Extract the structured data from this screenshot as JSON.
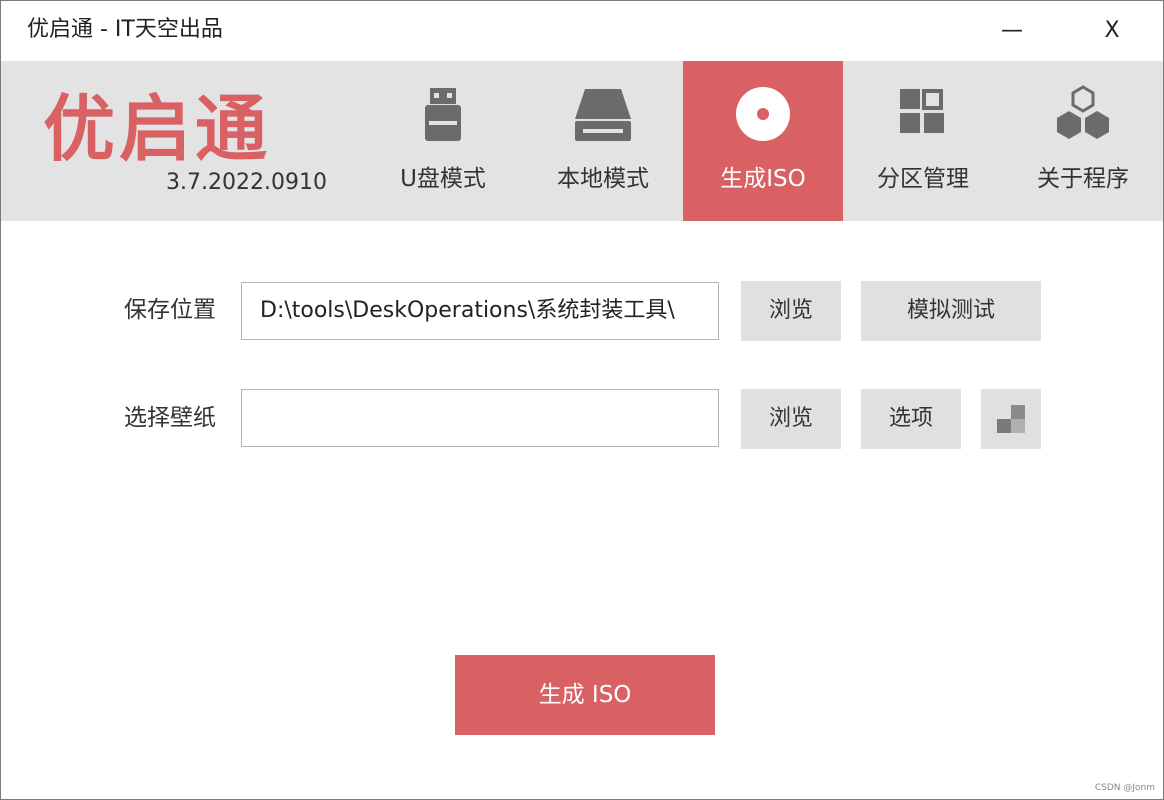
{
  "window": {
    "title": "优启通 - IT天空出品",
    "minimize_label": "—",
    "close_label": "X"
  },
  "header": {
    "logo": "优启通",
    "version": "3.7.2022.0910",
    "tabs": [
      {
        "label": "U盘模式",
        "icon": "usb-drive-icon"
      },
      {
        "label": "本地模式",
        "icon": "hard-disk-icon"
      },
      {
        "label": "生成ISO",
        "icon": "disc-icon",
        "active": true
      },
      {
        "label": "分区管理",
        "icon": "partition-grid-icon"
      },
      {
        "label": "关于程序",
        "icon": "hexagons-icon"
      }
    ]
  },
  "form": {
    "save_location": {
      "label": "保存位置",
      "value": "D:\\tools\\DeskOperations\\系统封装工具\\",
      "browse": "浏览",
      "simulate": "模拟测试"
    },
    "wallpaper": {
      "label": "选择壁纸",
      "value": "",
      "browse": "浏览",
      "options": "选项"
    }
  },
  "actions": {
    "generate": "生成 ISO"
  },
  "watermark": "CSDN @Jonm",
  "colors": {
    "accent": "#d96063",
    "header_bg": "#e3e3e3",
    "button_bg": "#e0e0e0",
    "icon": "#6b6b6b"
  }
}
